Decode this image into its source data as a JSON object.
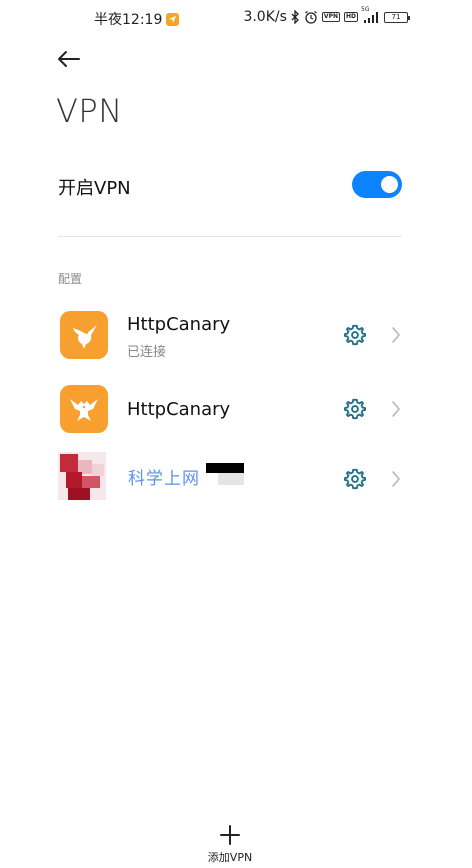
{
  "status_bar": {
    "time": "半夜12:19",
    "network_speed": "3.0K/s",
    "vpn_badge": "VPN",
    "hd_badge": "HD",
    "signal_label": "5G",
    "battery": "71"
  },
  "header": {
    "title": "VPN"
  },
  "toggle": {
    "label": "开启VPN",
    "enabled": true,
    "accent_color": "#0d84ff"
  },
  "section": {
    "label": "配置"
  },
  "vpn_list": [
    {
      "name": "HttpCanary",
      "status": "已连接",
      "icon": "hummingbird-icon"
    },
    {
      "name": "HttpCanary",
      "status": "",
      "icon": "eagle-icon"
    },
    {
      "name": "科学上网",
      "status": "",
      "icon": "censored-icon"
    }
  ],
  "footer": {
    "add_label": "添加VPN"
  },
  "colors": {
    "icon_orange": "#f7a030",
    "gear_teal": "#1e6f86"
  }
}
